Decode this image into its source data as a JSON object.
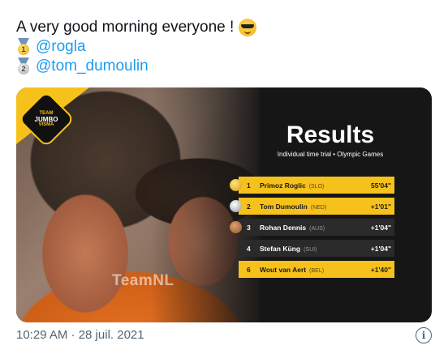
{
  "tweet": {
    "line1": "A very good morning everyone !",
    "line1_emoji": "sunglasses-smiley-icon",
    "mentions": [
      {
        "medal": "gold",
        "medal_number": "1",
        "handle": "@rogla"
      },
      {
        "medal": "silver",
        "medal_number": "2",
        "handle": "@tom_dumoulin"
      }
    ]
  },
  "card": {
    "team_logo": {
      "line1": "TEAM",
      "line2": "JUMBO",
      "line3": "VISMA"
    },
    "photo_text": "TeamNL",
    "results_title": "Results",
    "results_subtitle": "Individual time trial • Olympic Games",
    "rows": [
      {
        "pos": "1",
        "name": "Primoz Roglic",
        "nat": "(SLO)",
        "time": "55'04\"",
        "style": "hl",
        "ball": "gold"
      },
      {
        "pos": "2",
        "name": "Tom Dumoulin",
        "nat": "(NED)",
        "time": "+1'01\"",
        "style": "hl",
        "ball": "silver"
      },
      {
        "pos": "3",
        "name": "Rohan Dennis",
        "nat": "(AUS)",
        "time": "+1'04\"",
        "style": "dark",
        "ball": "bronze"
      },
      {
        "pos": "4",
        "name": "Stefan Küng",
        "nat": "(SUI)",
        "time": "+1'04\"",
        "style": "dark",
        "ball": ""
      },
      {
        "pos": "6",
        "name": "Wout van Aert",
        "nat": "(BEL)",
        "time": "+1'40\"",
        "style": "hl",
        "ball": ""
      }
    ],
    "accent_color": "#f7c11c"
  },
  "footer": {
    "timestamp": "10:29 AM · 28 juil. 2021",
    "info_icon": "i"
  }
}
